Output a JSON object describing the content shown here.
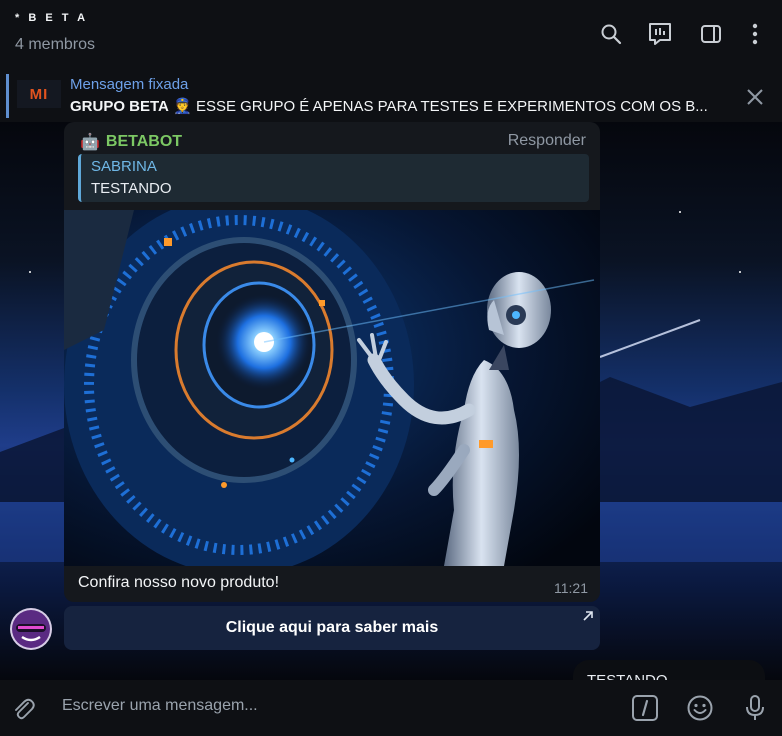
{
  "header": {
    "title": "* B E T A",
    "subtitle": "4 membros",
    "icons": [
      "search-icon",
      "poll-icon",
      "sidebar-toggle-icon",
      "more-vertical-icon"
    ]
  },
  "pinned": {
    "label": "Mensagem fixada",
    "thumb_text": "MI",
    "text_bold": "GRUPO BETA",
    "emoji": "👮",
    "text": "ESSE GRUPO É APENAS PARA TESTES E EXPERIMENTOS COM OS B..."
  },
  "message": {
    "sender_emoji": "🤖",
    "sender": "BETABOT",
    "reply_label": "Responder",
    "quote_author": "SABRINA",
    "quote_text": "TESTANDO",
    "caption": "Confira nosso novo produto!",
    "time": "11:21",
    "button_label": "Clique aqui para saber mais"
  },
  "outgoing": {
    "text": "TESTANDO"
  },
  "input": {
    "placeholder": "Escrever uma mensagem..."
  },
  "colors": {
    "accent": "#6da0e8",
    "sender": "#7cc864",
    "quote": "#5fa8d8",
    "background": "#0b0d12"
  }
}
